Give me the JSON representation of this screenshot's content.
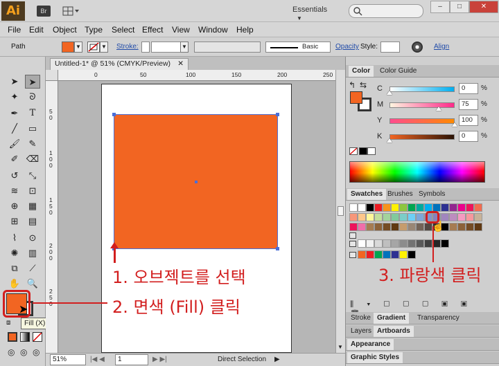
{
  "appbar": {
    "logo": "Ai",
    "bridge": "Br",
    "workspace": "Essentials",
    "search_placeholder": "",
    "window_controls": [
      "–",
      "□",
      "✕"
    ]
  },
  "menubar": {
    "items": [
      "File",
      "Edit",
      "Object",
      "Type",
      "Select",
      "Effect",
      "View",
      "Window",
      "Help"
    ]
  },
  "controlbar": {
    "selection_label": "Path",
    "stroke_label": "Stroke:",
    "brush_label": "Basic",
    "opacity_label": "Opacity",
    "style_label": "Style:",
    "align_label": "Align",
    "fill_color": "#f26522"
  },
  "document": {
    "tab_title": "Untitled-1* @ 51% (CMYK/Preview)",
    "ruler_h": [
      "0",
      "50",
      "100",
      "150",
      "200",
      "250"
    ],
    "ruler_v": [
      "5\n0",
      "1\n0\n0",
      "1\n5\n0",
      "2\n0\n0",
      "2\n5\n0"
    ],
    "object_color": "#f26522",
    "zoom": "51%",
    "artboard_num": "1",
    "tool_status": "Direct Selection"
  },
  "tools": {
    "fill_tooltip": "Fill (X)",
    "fill_color": "#f26522"
  },
  "color_panel": {
    "tabs": [
      "Color",
      "Color Guide"
    ],
    "channels": [
      {
        "label": "C",
        "value": "0",
        "pct": "%",
        "level": 0.0,
        "gradient": "linear-gradient(to right,#ffffff,#00aeef)"
      },
      {
        "label": "M",
        "value": "75",
        "pct": "%",
        "level": 0.75,
        "gradient": "linear-gradient(to right,#fff5e0,#ff2a8a)"
      },
      {
        "label": "Y",
        "value": "100",
        "pct": "%",
        "level": 1.0,
        "gradient": "linear-gradient(to right,#ff4c90,#ff8a00)"
      },
      {
        "label": "K",
        "value": "0",
        "pct": "%",
        "level": 0.0,
        "gradient": "linear-gradient(to right,#f26522,#2b1305)"
      }
    ]
  },
  "swatches_panel": {
    "tabs": [
      "Swatches",
      "Brushes",
      "Symbols"
    ],
    "rows": [
      [
        "#ffffff",
        "#ffffff",
        "#000000",
        "#ed1c24",
        "#f7941d",
        "#fff200",
        "#8dc63f",
        "#00a651",
        "#00a99d",
        "#00aeef",
        "#0072bc",
        "#2e3192",
        "#92278f",
        "#ec008c",
        "#ed145b",
        "#f26c4f"
      ],
      [
        "#f7977a",
        "#fdc68a",
        "#fff79a",
        "#c4df9b",
        "#a3d39c",
        "#82ca9d",
        "#7bcdc8",
        "#6dcff6",
        "#7da7d9",
        "#8393ca",
        "#8781bd",
        "#a186be",
        "#bd8cbf",
        "#f49ac1",
        "#f6989d",
        "#c7b299"
      ],
      [
        "#ed145b",
        "#f06eaa",
        "#a67c52",
        "#8c6239",
        "#754c24",
        "#603913",
        "#c69c6d",
        "#998675",
        "#736357",
        "#534741",
        "#362f2d",
        "#000000",
        "#a67c52",
        "#8c6239",
        "#754c24",
        "#603913"
      ],
      [
        "#ffffff",
        "#f2f2f2",
        "#d9d9d9",
        "#bfbfbf",
        "#a6a6a6",
        "#8c8c8c",
        "#737373",
        "#595959",
        "#404040",
        "#262626",
        "#000000"
      ],
      [
        "#f26522",
        "#ed1c24",
        "#00a651",
        "#0072bc",
        "#2e3192",
        "#fff200",
        "#000000"
      ]
    ]
  },
  "lower_panels": {
    "stroke_row": [
      "Stroke",
      "Gradient",
      "Transparency"
    ],
    "layers_row": [
      "Layers",
      "Artboards"
    ],
    "appearance": "Appearance",
    "graphic_styles": "Graphic Styles"
  },
  "annotations": {
    "select_object": "1. 오브젝트를 선택",
    "fill_click": "2. 면색 (Fill) 클릭",
    "blue_click": "3. 파랑색 클릭"
  }
}
